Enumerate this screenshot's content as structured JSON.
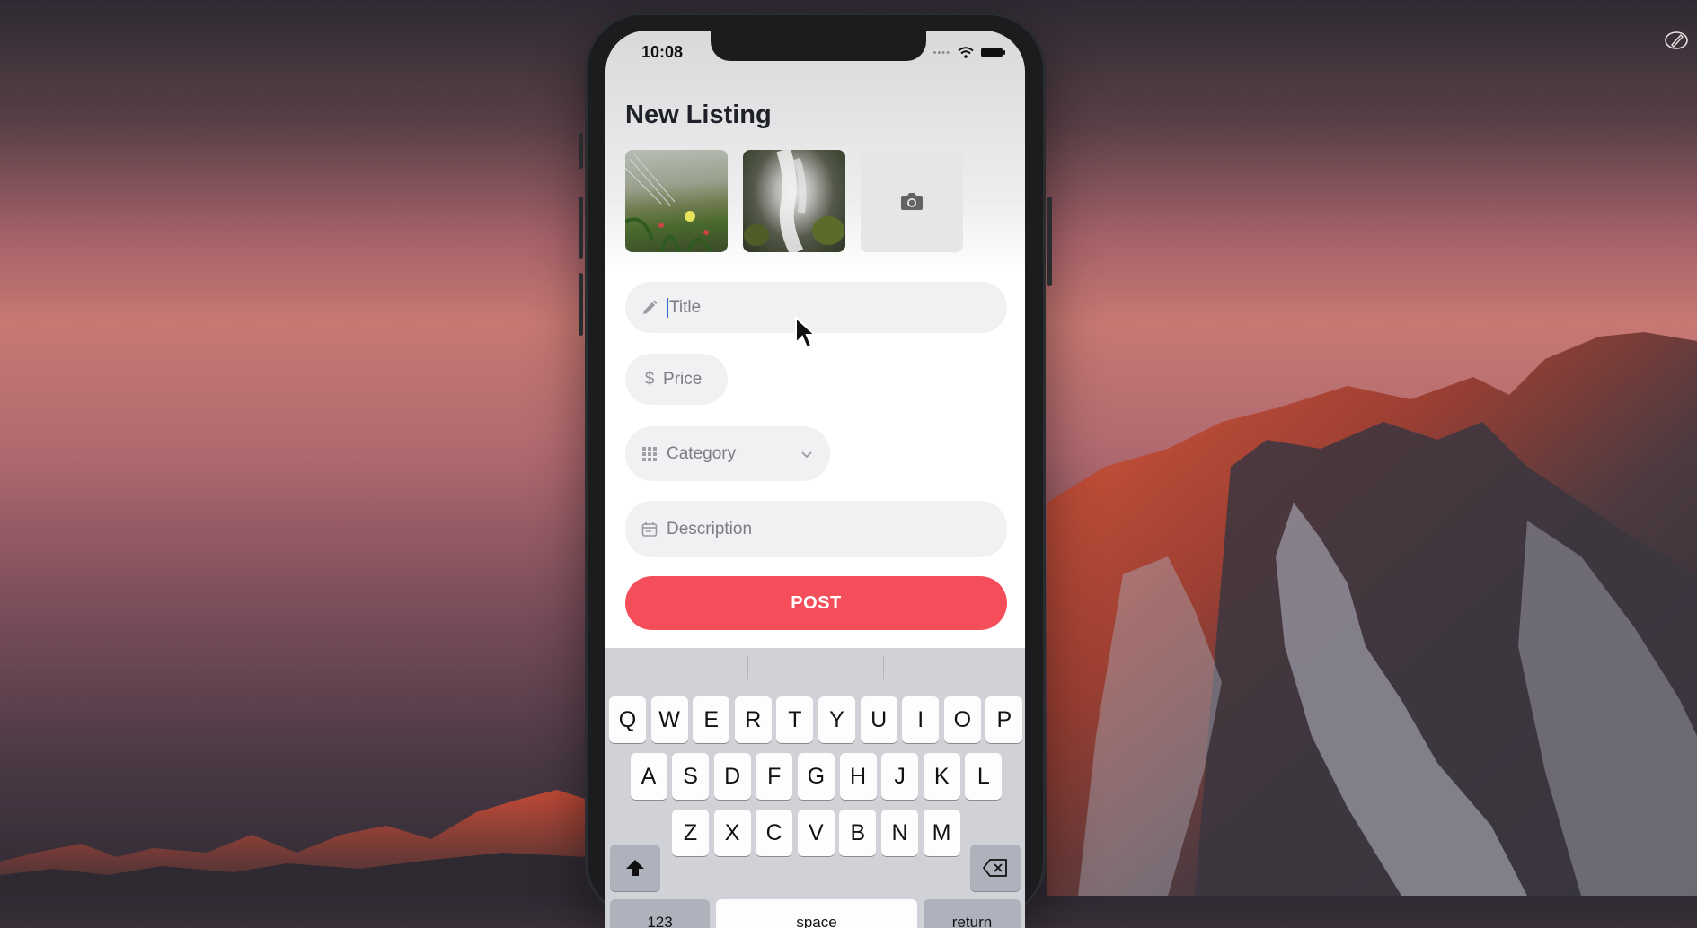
{
  "phone": {
    "status_time": "10:08",
    "status_icons": [
      "signal-dots-icon",
      "wifi-icon",
      "battery-icon"
    ]
  },
  "screen": {
    "title": "New Listing",
    "photos": [
      "photo-meadow-flowers",
      "photo-waterfall"
    ],
    "add_photo_icon": "camera-icon"
  },
  "form": {
    "title_placeholder": "Title",
    "price_placeholder": "Price",
    "category_placeholder": "Category",
    "description_placeholder": "Description",
    "post_label": "POST"
  },
  "keyboard": {
    "row1": [
      "Q",
      "W",
      "E",
      "R",
      "T",
      "Y",
      "U",
      "I",
      "O",
      "P"
    ],
    "row2": [
      "A",
      "S",
      "D",
      "F",
      "G",
      "H",
      "J",
      "K",
      "L"
    ],
    "row3": [
      "Z",
      "X",
      "C",
      "V",
      "B",
      "N",
      "M"
    ],
    "numbers_label": "123",
    "space_label": "space",
    "return_label": "return"
  },
  "colors": {
    "accent": "#f44e5a",
    "field_bg": "#f1f1f3",
    "keyboard_bg": "#d0d2d8"
  }
}
